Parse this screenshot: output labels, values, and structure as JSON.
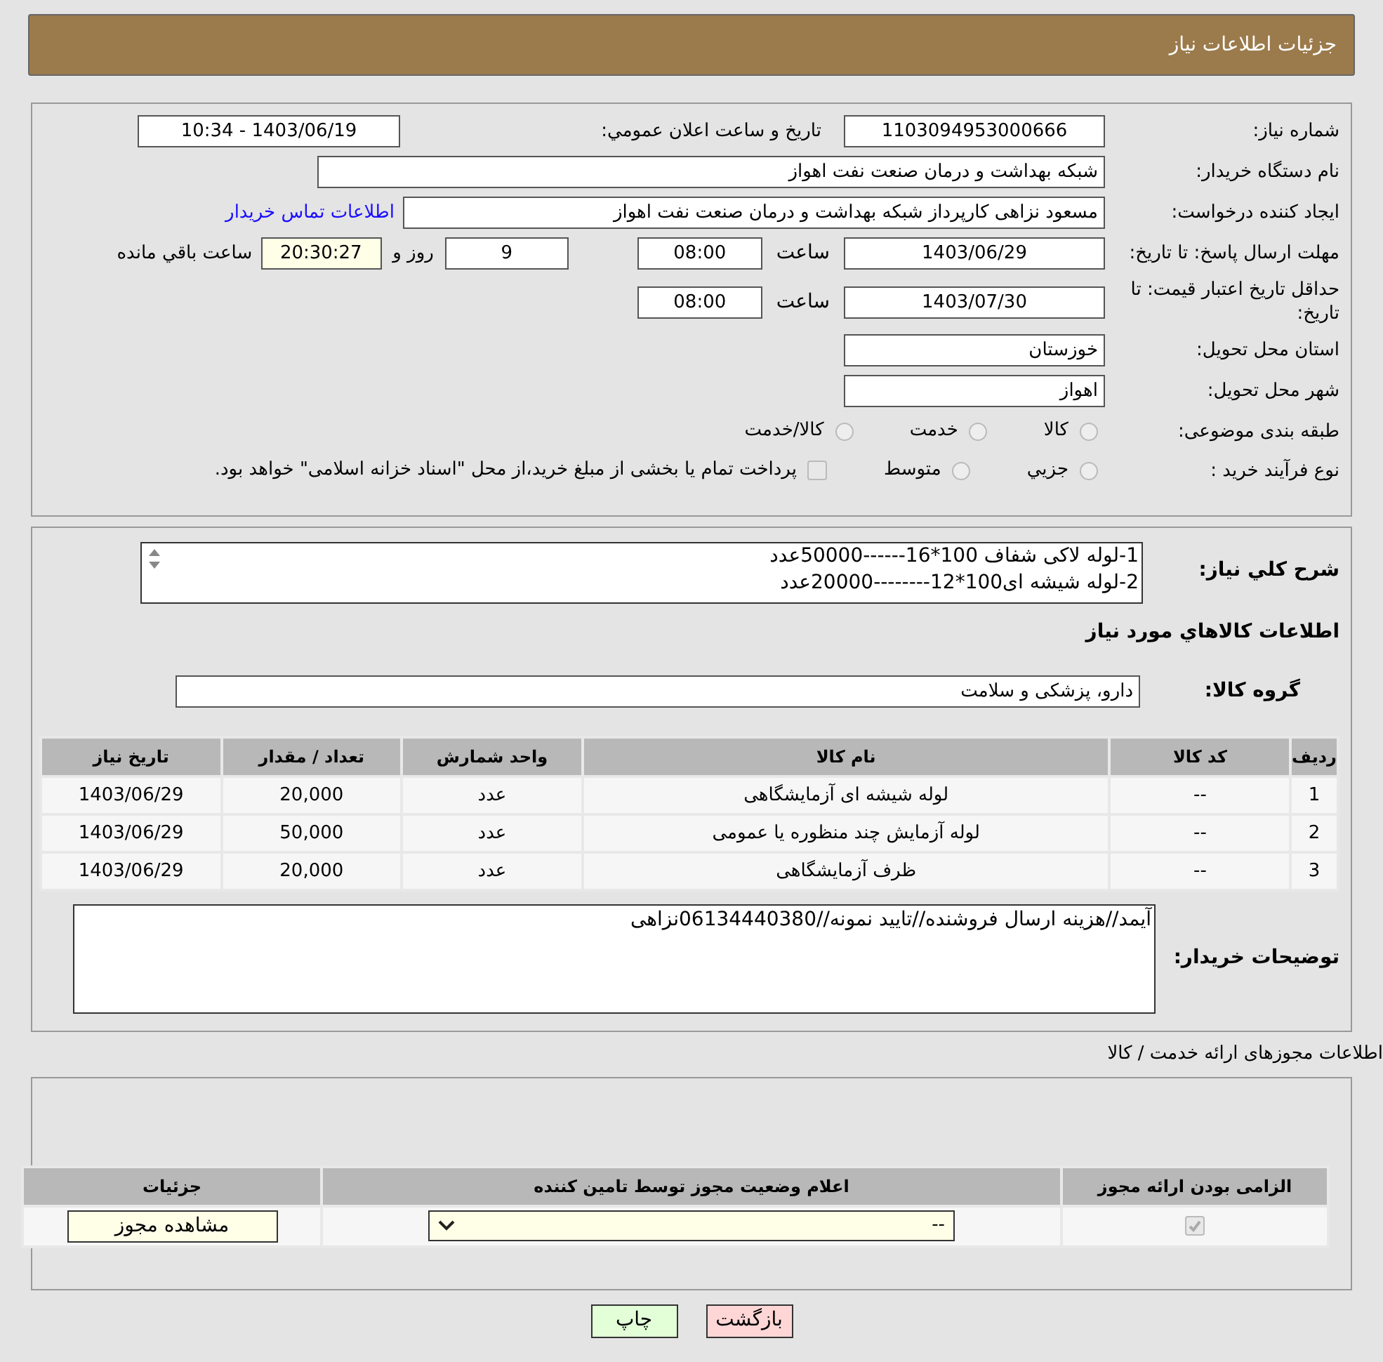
{
  "header": {
    "title": "جزئیات اطلاعات نیاز"
  },
  "need_number": {
    "label": "شماره نیاز:",
    "value": "1103094953000666"
  },
  "announce": {
    "label": "تاریخ و ساعت اعلان عمومي:",
    "value": "1403/06/19 - 10:34"
  },
  "buyer_org": {
    "label": "نام دستگاه خریدار:",
    "value": "شبکه بهداشت و درمان صنعت نفت اهواز"
  },
  "requester": {
    "label": "ایجاد کننده درخواست:",
    "value": "مسعود نزاهی کارپرداز شبکه بهداشت و درمان صنعت نفت اهواز",
    "link": "اطلاعات تماس خریدار"
  },
  "response_deadline": {
    "label": "مهلت ارسال پاسخ: تا تاریخ:",
    "date": "1403/06/29",
    "time_label": "ساعت",
    "time": "08:00",
    "days": "9",
    "days_label": "روز و",
    "remaining": "20:30:27",
    "remaining_label": "ساعت باقي مانده"
  },
  "price_validity": {
    "label": "حداقل تاریخ اعتبار قیمت: تا تاریخ:",
    "date": "1403/07/30",
    "time_label": "ساعت",
    "time": "08:00"
  },
  "province": {
    "label": "استان محل تحویل:",
    "value": "خوزستان"
  },
  "city": {
    "label": "شهر محل تحویل:",
    "value": "اهواز"
  },
  "category": {
    "label": "طبقه بندی موضوعی:",
    "options": [
      {
        "label": "کالا",
        "selected": false
      },
      {
        "label": "خدمت",
        "selected": false
      },
      {
        "label": "کالا/خدمت",
        "selected": false
      }
    ]
  },
  "process": {
    "label": "نوع فرآیند خرید :",
    "options": [
      {
        "label": "جزيي",
        "selected": false
      },
      {
        "label": "متوسط",
        "selected": false
      }
    ],
    "treasury": {
      "checked": false,
      "text": "پرداخت تمام یا بخشی از مبلغ خرید،از محل \"اسناد خزانه اسلامی\" خواهد بود."
    }
  },
  "description": {
    "label": "شرح كلي نياز:",
    "lines": [
      "1-لوله لاکی شفاف 100*16------50000عدد",
      "2-لوله شیشه ای100*12--------20000عدد"
    ]
  },
  "goods_title": "اطلاعات كالاهاي مورد نياز",
  "goods_group": {
    "label": "گروه كالا:",
    "value": "دارو، پزشکی و سلامت"
  },
  "goods_table": {
    "columns": [
      "رديف",
      "کد کالا",
      "نام کالا",
      "واحد شمارش",
      "تعداد / مقدار",
      "تاریخ نیاز"
    ],
    "rows": [
      [
        "1",
        "--",
        "لوله شیشه ای آزمایشگاهی",
        "عدد",
        "20,000",
        "1403/06/29"
      ],
      [
        "2",
        "--",
        "لوله آزمایش چند منظوره یا عمومی",
        "عدد",
        "50,000",
        "1403/06/29"
      ],
      [
        "3",
        "--",
        "ظرف آزمایشگاهی",
        "عدد",
        "20,000",
        "1403/06/29"
      ]
    ]
  },
  "buyer_notes": {
    "label": "توضیحات خریدار:",
    "value": "آیمد//هزینه ارسال فروشنده//تایید نمونه//06134440380نزاهی"
  },
  "permits_title": "اطلاعات مجوزهای ارائه خدمت / کالا",
  "permits_table": {
    "columns": [
      "الزامی بودن ارائه مجوز",
      "اعلام وضعیت مجوز توسط تامین کننده",
      "جزئیات"
    ],
    "rows": [
      {
        "required": true,
        "status": "--",
        "details_button": "مشاهده مجوز"
      }
    ]
  },
  "buttons": [
    {
      "kind": "back",
      "label": "بازگشت"
    },
    {
      "kind": "print",
      "label": "چاپ"
    }
  ]
}
